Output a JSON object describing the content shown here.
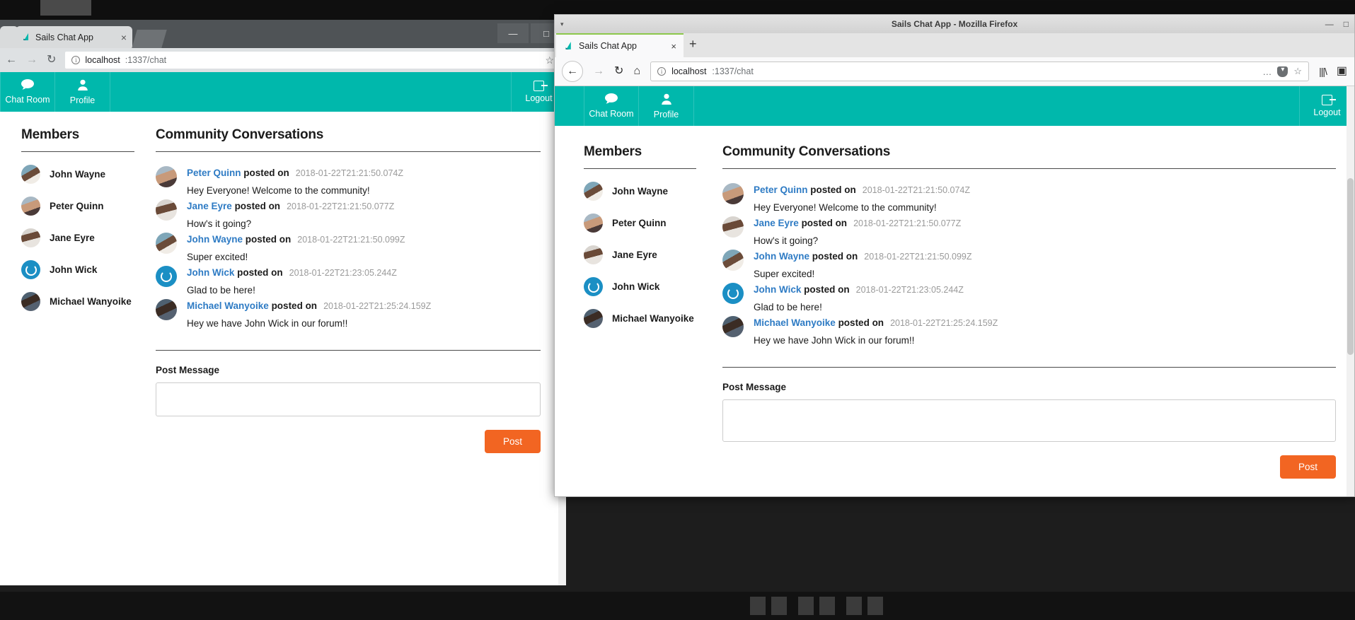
{
  "desktop": {
    "background_color": "#1d1d1d"
  },
  "chrome_window": {
    "tab_title": "Sails Chat App",
    "tab_close": "×",
    "window_minimize": "—",
    "window_maximize": "□",
    "back_icon": "←",
    "forward_icon": "→",
    "reload_icon": "↻",
    "url_host": "localhost",
    "url_path": ":1337/chat",
    "star_icon": "☆",
    "info_icon": "i"
  },
  "firefox_window": {
    "title": "Sails Chat App - Mozilla Firefox",
    "menu_arrow": "▾",
    "window_minimize": "—",
    "window_maximize": "□",
    "tab_title": "Sails Chat App",
    "tab_close": "×",
    "new_tab": "+",
    "back_icon": "←",
    "forward_icon": "→",
    "reload_icon": "↻",
    "home_icon": "⌂",
    "url_host": "localhost",
    "url_path": ":1337/chat",
    "info_icon": "i",
    "page_actions_icon": "…",
    "pocket_icon": "▾",
    "bookmark_icon": "☆",
    "library_icon": "|||\\",
    "sidebar_icon": "▣"
  },
  "app": {
    "navbar": {
      "items": [
        {
          "label": "Chat Room",
          "icon": "speech-bubble"
        },
        {
          "label": "Profile",
          "icon": "person"
        }
      ],
      "logout_label": "Logout",
      "logout_icon": "logout-arrow",
      "background_color": "#00b8ac"
    },
    "members": {
      "title": "Members",
      "list": [
        {
          "name": "John Wayne",
          "avatar": "av-jw"
        },
        {
          "name": "Peter Quinn",
          "avatar": "av-pq"
        },
        {
          "name": "Jane Eyre",
          "avatar": "av-je"
        },
        {
          "name": "John Wick",
          "avatar": "av-jwk"
        },
        {
          "name": "Michael Wanyoike",
          "avatar": "av-mw"
        }
      ]
    },
    "chat": {
      "title": "Community Conversations",
      "posted_on_label": "posted on",
      "messages": [
        {
          "author": "Peter Quinn",
          "time": "2018-01-22T21:21:50.074Z",
          "text": "Hey Everyone! Welcome to the community!",
          "avatar": "av-pq"
        },
        {
          "author": "Jane Eyre",
          "time": "2018-01-22T21:21:50.077Z",
          "text": "How's it going?",
          "avatar": "av-je"
        },
        {
          "author": "John Wayne",
          "time": "2018-01-22T21:21:50.099Z",
          "text": "Super excited!",
          "avatar": "av-jw"
        },
        {
          "author": "John Wick",
          "time": "2018-01-22T21:23:05.244Z",
          "text": "Glad to be here!",
          "avatar": "av-jwk"
        },
        {
          "author": "Michael Wanyoike",
          "time": "2018-01-22T21:25:24.159Z",
          "text": "Hey we have John Wick in our forum!!",
          "avatar": "av-mw"
        }
      ]
    },
    "post": {
      "label": "Post Message",
      "textarea_value": "",
      "textarea_placeholder": "",
      "button_label": "Post",
      "button_color": "#f26522"
    }
  }
}
